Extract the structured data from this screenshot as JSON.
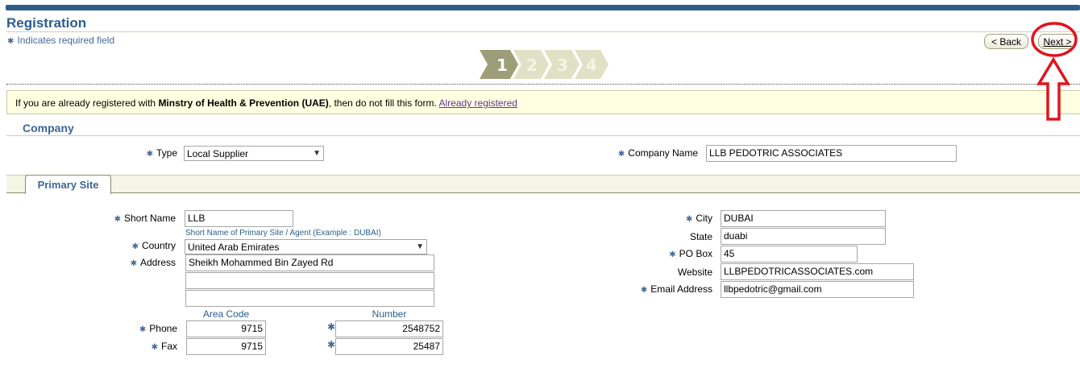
{
  "header": {
    "title": "Registration",
    "required_note": "Indicates required field",
    "back_label": "< Back",
    "next_label": "Next >"
  },
  "steps": [
    "1",
    "2",
    "3",
    "4"
  ],
  "notice": {
    "prefix": "If you are already registered with",
    "org": "Minstry of Health & Prevention (UAE)",
    "suffix": ", then do not fill this form.",
    "link": "Already registered"
  },
  "company": {
    "section_title": "Company",
    "type_label": "Type",
    "type_value": "Local Supplier",
    "name_label": "Company Name",
    "name_value": "LLB PEDOTRIC ASSOCIATES"
  },
  "primary_site": {
    "tab_label": "Primary Site",
    "short_name_label": "Short Name",
    "short_name_value": "LLB",
    "short_name_hint": "Short Name of Primary Site / Agent (Example : DUBAI)",
    "country_label": "Country",
    "country_value": "United Arab Emirates",
    "address_label": "Address",
    "address_line1": "Sheikh Mohammed Bin Zayed Rd",
    "address_line2": "",
    "address_line3": "",
    "area_code_head": "Area Code",
    "number_head": "Number",
    "phone_label": "Phone",
    "phone_area": "9715",
    "phone_number": "2548752",
    "fax_label": "Fax",
    "fax_area": "9715",
    "fax_number": "25487",
    "city_label": "City",
    "city_value": "DUBAI",
    "state_label": "State",
    "state_value": "duabi",
    "pobox_label": "PO Box",
    "pobox_value": "45",
    "website_label": "Website",
    "website_value": "LLBPEDOTRICASSOCIATES.com",
    "email_label": "Email Address",
    "email_value": "llbpedotric@gmail.com"
  },
  "colors": {
    "brand": "#2e5c8a",
    "label_blue": "#2a5d8c",
    "notice_bg": "#ffffe2",
    "annotation_red": "#e0141e"
  },
  "icons": {
    "required_star": "required-star-icon",
    "dropdown": "chevron-down-icon",
    "annotation_arrow": "up-arrow-icon"
  }
}
